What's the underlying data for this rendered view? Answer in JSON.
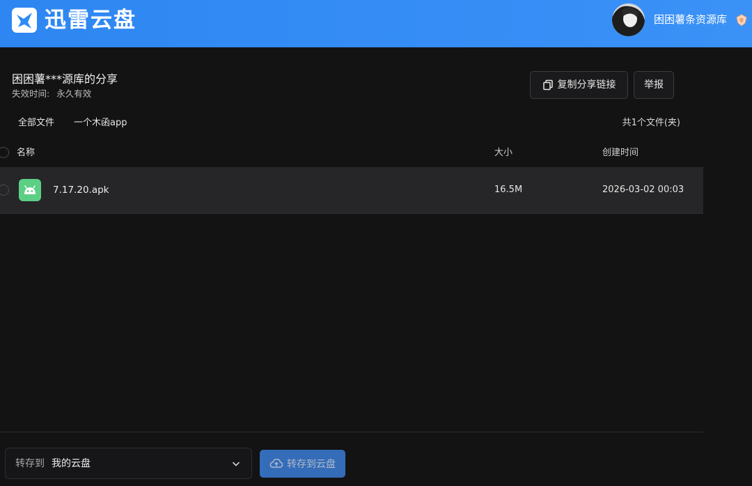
{
  "header": {
    "brand": "迅雷云盘",
    "user_name": "困困薯条资源库",
    "logo_icon": "thunder-bird-icon",
    "accent_color": "#2f8cf5"
  },
  "share": {
    "title": "困困薯***源库的分享",
    "expiry_label": "失效时间:",
    "expiry_value": "永久有效",
    "copy_link_label": "复制分享链接",
    "report_label": "举报"
  },
  "breadcrumb": {
    "root": "全部文件",
    "current": "一个木函app",
    "count": "共1个文件(夹)"
  },
  "table": {
    "columns": [
      "名称",
      "大小",
      "创建时间"
    ],
    "rows": [
      {
        "name": "7.17.20.apk",
        "size": "16.5M",
        "created": "2026-03-02 00:03",
        "icon": "android-apk-icon"
      }
    ]
  },
  "footer": {
    "save_to_label": "转存到",
    "save_to_value": "我的云盘",
    "save_button": "转存到云盘"
  }
}
